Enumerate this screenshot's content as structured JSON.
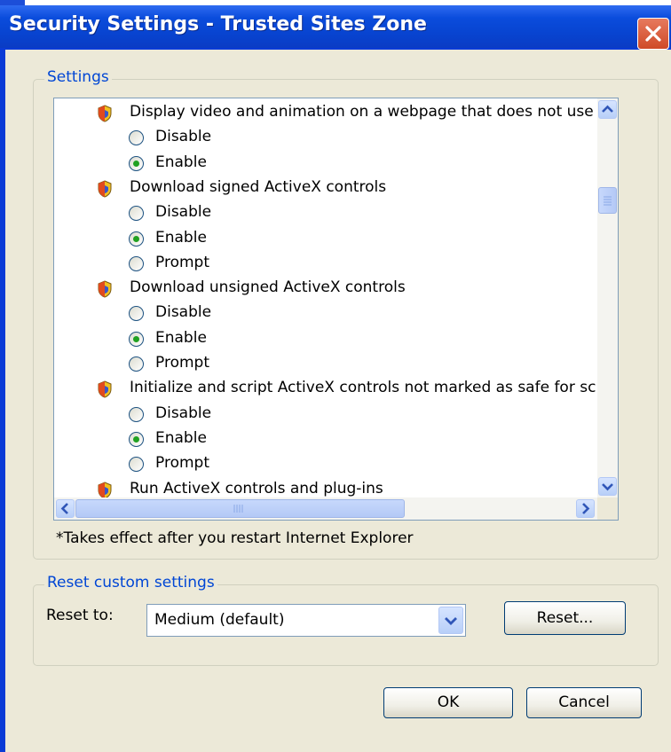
{
  "window": {
    "title": "Security Settings - Trusted Sites Zone"
  },
  "settings_group": {
    "legend": "Settings",
    "items": [
      {
        "type": "category",
        "label": "Display video and animation on a webpage that does not use"
      },
      {
        "type": "option",
        "label": "Disable",
        "checked": false
      },
      {
        "type": "option",
        "label": "Enable",
        "checked": true
      },
      {
        "type": "category",
        "label": "Download signed ActiveX controls"
      },
      {
        "type": "option",
        "label": "Disable",
        "checked": false
      },
      {
        "type": "option",
        "label": "Enable",
        "checked": true
      },
      {
        "type": "option",
        "label": "Prompt",
        "checked": false
      },
      {
        "type": "category",
        "label": "Download unsigned ActiveX controls"
      },
      {
        "type": "option",
        "label": "Disable",
        "checked": false
      },
      {
        "type": "option",
        "label": "Enable",
        "checked": true
      },
      {
        "type": "option",
        "label": "Prompt",
        "checked": false
      },
      {
        "type": "category",
        "label": "Initialize and script ActiveX controls not marked as safe for sc"
      },
      {
        "type": "option",
        "label": "Disable",
        "checked": false
      },
      {
        "type": "option",
        "label": "Enable",
        "checked": true
      },
      {
        "type": "option",
        "label": "Prompt",
        "checked": false
      },
      {
        "type": "category",
        "label": "Run ActiveX controls and plug-ins"
      }
    ],
    "note": "*Takes effect after you restart Internet Explorer"
  },
  "reset_group": {
    "legend": "Reset custom settings",
    "reset_to_label": "Reset to:",
    "reset_to_value": "Medium (default)",
    "reset_button": "Reset..."
  },
  "buttons": {
    "ok": "OK",
    "cancel": "Cancel"
  },
  "colors": {
    "titlebar": "#0a4cdc",
    "dialog_bg": "#ece9d8",
    "legend_text": "#0046d5",
    "radio_dot": "#21a121"
  }
}
